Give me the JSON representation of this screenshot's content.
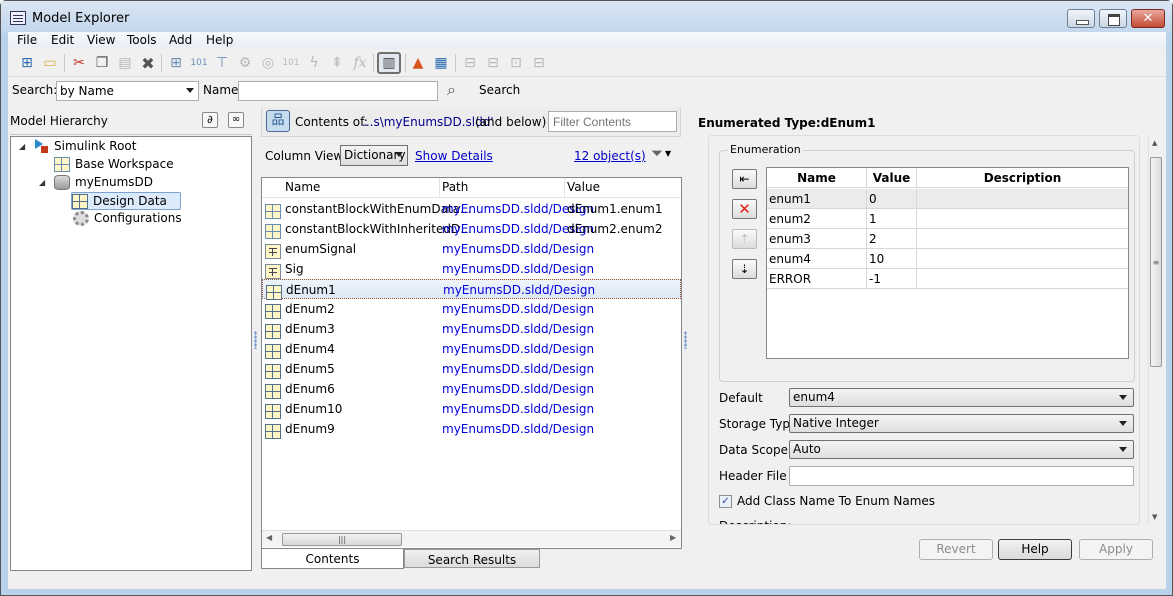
{
  "window": {
    "title": "Model Explorer",
    "controls": {
      "minimize": "minimize",
      "maximize": "maximize",
      "close": "close"
    }
  },
  "menu": [
    "File",
    "Edit",
    "View",
    "Tools",
    "Add",
    "Help"
  ],
  "toolbar": {
    "icons": [
      "new-model-icon",
      "open-folder-icon",
      "cut-icon",
      "copy-icon",
      "paste-icon",
      "delete-icon",
      "add-workspace-var-icon",
      "add-enum-icon",
      "add-signal-icon",
      "configuration-icon",
      "config-ref-icon",
      "bus-icon",
      "stateflow-event-icon",
      "stateflow-data-icon",
      "function-icon",
      "dialog-view-icon",
      "matlab-icon",
      "simulink-library-icon",
      "filter-icon",
      "compare-icon",
      "export-icon",
      "import-icon"
    ]
  },
  "search": {
    "label": "Search:",
    "mode": "by Name",
    "name_label": "Name:",
    "name_value": "",
    "button": "Search"
  },
  "left": {
    "header": "Model Hierarchy",
    "tree": [
      {
        "label": "Simulink Root",
        "icon": "simulink-root-icon",
        "level": 0,
        "expanded": true
      },
      {
        "label": "Base Workspace",
        "icon": "workspace-icon",
        "level": 1
      },
      {
        "label": "myEnumsDD",
        "icon": "data-dictionary-icon",
        "level": 1,
        "expanded": true
      },
      {
        "label": "Design Data",
        "icon": "design-data-icon",
        "level": 2,
        "selected": true
      },
      {
        "label": "Configurations",
        "icon": "configurations-icon",
        "level": 2
      }
    ]
  },
  "middle": {
    "contents_label": "Contents of:",
    "contents_path": "...s\\myEnumsDD.sldd'",
    "contents_scope": "(and below)",
    "filter_placeholder": "Filter Contents",
    "column_view_label": "Column View:",
    "column_view_value": "Dictionary",
    "show_details": "Show Details",
    "object_count": "12 object(s)",
    "columns": [
      "Name",
      "Path",
      "Value"
    ],
    "rows": [
      {
        "icon": "variable-icon",
        "name": "constantBlockWithEnumData...",
        "path": "myEnumsDD.sldd/Design",
        "value": "dEnum1.enum1"
      },
      {
        "icon": "variable-icon",
        "name": "constantBlockWithInheritedD...",
        "path": "myEnumsDD.sldd/Design",
        "value": "dEnum2.enum2"
      },
      {
        "icon": "signal-icon",
        "name": "enumSignal",
        "path": "myEnumsDD.sldd/Design",
        "value": ""
      },
      {
        "icon": "signal-icon",
        "name": "Sig",
        "path": "myEnumsDD.sldd/Design",
        "value": ""
      },
      {
        "icon": "enum-type-icon",
        "name": "dEnum1",
        "path": "myEnumsDD.sldd/Design",
        "value": "",
        "selected": true
      },
      {
        "icon": "enum-type-icon",
        "name": "dEnum2",
        "path": "myEnumsDD.sldd/Design",
        "value": ""
      },
      {
        "icon": "enum-type-icon",
        "name": "dEnum3",
        "path": "myEnumsDD.sldd/Design",
        "value": ""
      },
      {
        "icon": "enum-type-icon",
        "name": "dEnum4",
        "path": "myEnumsDD.sldd/Design",
        "value": ""
      },
      {
        "icon": "enum-type-icon",
        "name": "dEnum5",
        "path": "myEnumsDD.sldd/Design",
        "value": ""
      },
      {
        "icon": "enum-type-icon",
        "name": "dEnum6",
        "path": "myEnumsDD.sldd/Design",
        "value": ""
      },
      {
        "icon": "enum-type-icon",
        "name": "dEnum10",
        "path": "myEnumsDD.sldd/Design",
        "value": ""
      },
      {
        "icon": "enum-type-icon",
        "name": "dEnum9",
        "path": "myEnumsDD.sldd/Design",
        "value": ""
      }
    ],
    "tabs": [
      "Contents",
      "Search Results"
    ],
    "active_tab": "Contents"
  },
  "right": {
    "title": "Enumerated Type:dEnum1",
    "enumeration_label": "Enumeration",
    "enum_columns": [
      "Name",
      "Value",
      "Description"
    ],
    "enum_rows": [
      {
        "name": "enum1",
        "value": "0",
        "description": ""
      },
      {
        "name": "enum2",
        "value": "1",
        "description": ""
      },
      {
        "name": "enum3",
        "value": "2",
        "description": ""
      },
      {
        "name": "enum4",
        "value": "10",
        "description": ""
      },
      {
        "name": "ERROR",
        "value": "-1",
        "description": ""
      }
    ],
    "enum_buttons": [
      "add-enum-icon",
      "delete-enum-icon",
      "move-up-icon",
      "move-down-icon"
    ],
    "default_label": "Default",
    "default_value": "enum4",
    "storage_label": "Storage Type",
    "storage_value": "Native Integer",
    "scope_label": "Data Scope",
    "scope_value": "Auto",
    "header_label": "Header File",
    "header_value": "",
    "add_class_label": "Add Class Name To Enum Names",
    "add_class_checked": true,
    "description_label": "Description:",
    "buttons": {
      "revert": "Revert",
      "help": "Help",
      "apply": "Apply"
    }
  }
}
